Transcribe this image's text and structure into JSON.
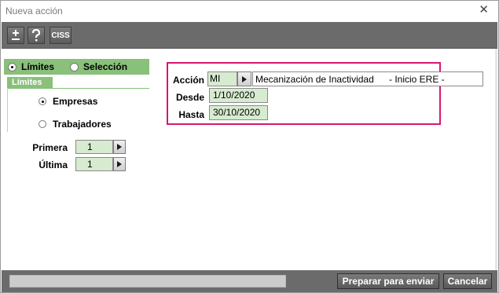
{
  "window": {
    "title": "Nueva acción"
  },
  "toolbar": {
    "buttons": [
      {
        "icon": "plus-minus-icon"
      },
      {
        "icon": "help-icon"
      },
      {
        "label": "CISS"
      }
    ]
  },
  "mode": {
    "limites_label": "Límites",
    "seleccion_label": "Selección",
    "selected": "Límites"
  },
  "limites_tab": {
    "label": "Límites",
    "empresas_label": "Empresas",
    "trabajadores_label": "Trabajadores",
    "selected": "Empresas",
    "primera_label": "Primera",
    "primera_value": "1",
    "ultima_label": "Última",
    "ultima_value": "1"
  },
  "accion": {
    "accion_label": "Acción",
    "code": "MI",
    "description": "Mecanización de Inactividad",
    "description_suffix": "- Inicio ERE -",
    "desde_label": "Desde",
    "desde_value": "1/10/2020",
    "hasta_label": "Hasta",
    "hasta_value": "30/10/2020"
  },
  "footer": {
    "send_label": "Preparar para enviar",
    "cancel_label": "Cancelar"
  },
  "colors": {
    "accent_green": "#89c07a",
    "field_green": "#d6ebcf",
    "highlight": "#d6186e",
    "toolbar_gray": "#6b6b6b"
  }
}
